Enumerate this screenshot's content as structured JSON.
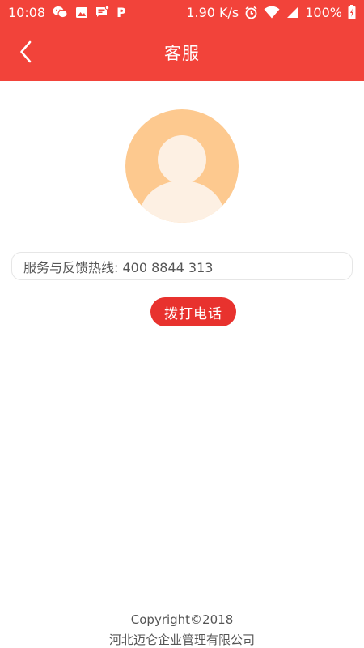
{
  "status_bar": {
    "time": "10:08",
    "net_speed": "1.90 K/s",
    "battery": "100%",
    "icons": [
      "wechat-icon",
      "image-icon",
      "message-icon",
      "p-app-icon",
      "alarm-icon",
      "wifi-icon",
      "signal-icon",
      "battery-icon"
    ],
    "p_icon_label": "P"
  },
  "nav": {
    "title": "客服"
  },
  "contact": {
    "hotline_text": "服务与反馈热线: 400 8844 313",
    "call_button_label": "拨打电话"
  },
  "footer": {
    "copyright": "Copyright©2018",
    "company": "河北迈仑企业管理有限公司"
  },
  "colors": {
    "header": "#f2433a",
    "call_button": "#e8322e",
    "avatar_bg": "#fdc98f",
    "avatar_figure": "#fdf0e3"
  }
}
